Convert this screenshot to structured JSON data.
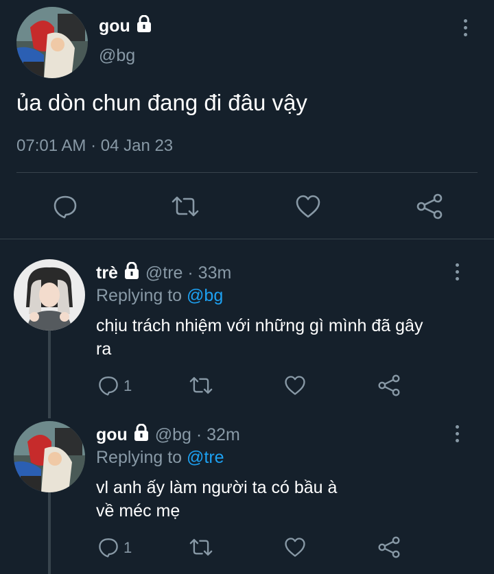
{
  "main_tweet": {
    "name": "gou",
    "handle": "@bg",
    "text": "ủa dòn chun đang đi đâu vậy",
    "timestamp": "07:01 AM · 04 Jan 23",
    "actions": [
      "reply-icon",
      "retweet-icon",
      "like-icon",
      "share-icon"
    ]
  },
  "replies": [
    {
      "name": "trè",
      "handle": "@tre",
      "time": "· 33m",
      "replying_label": "Replying to",
      "replying_to": "@bg",
      "text_line1": "chịu trách nhiệm với những gì mình đã gây",
      "text_line2": "ra",
      "reply_count": "1"
    },
    {
      "name": "gou",
      "handle": "@bg",
      "time": "· 32m",
      "replying_label": "Replying to",
      "replying_to": "@tre",
      "text_line1": "vl anh ấy làm người ta có bầu à",
      "text_line2": "về méc mẹ",
      "reply_count": "1"
    }
  ],
  "colors": {
    "background": "#15202b",
    "muted": "#8899a6",
    "link": "#1da1f2",
    "divider": "#38444d"
  }
}
